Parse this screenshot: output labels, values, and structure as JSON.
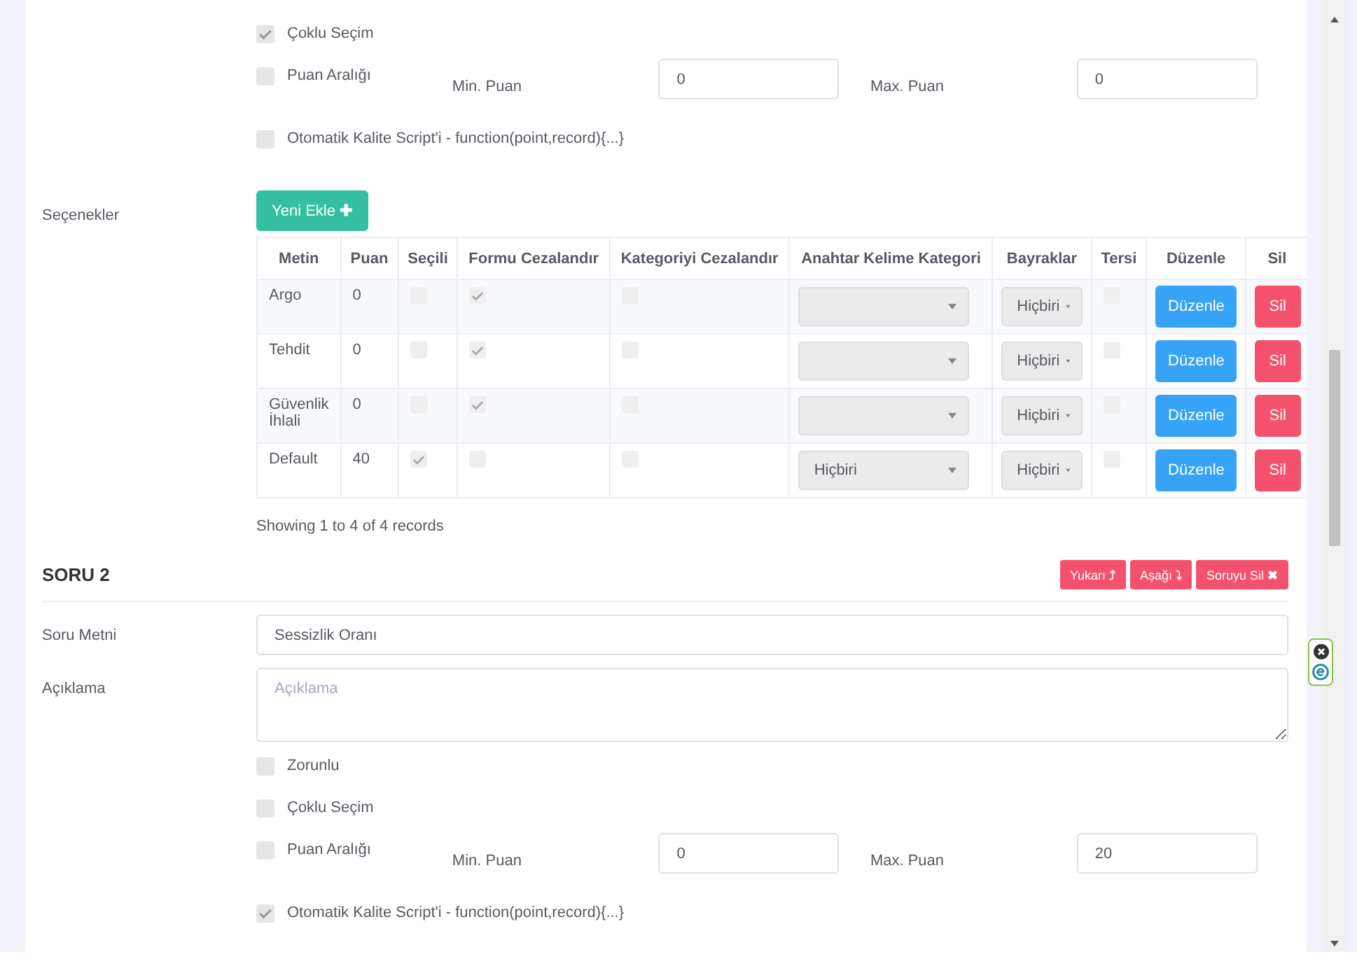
{
  "question1": {
    "options": [
      {
        "kind": "checkbox",
        "label": "Çoklu Seçim",
        "checked": true
      },
      {
        "kind": "range",
        "label": "Puan Aralığı",
        "checked": false,
        "min_label": "Min. Puan",
        "min_value": "0",
        "max_label": "Max. Puan",
        "max_value": "0"
      },
      {
        "kind": "checkbox",
        "label": "Otomatik Kalite Script'i - function(point,record){...}",
        "checked": false
      }
    ],
    "choices_label": "Seçenekler",
    "add_button": "Yeni Ekle",
    "add_icon": "✚",
    "table": {
      "columns": [
        "Metin",
        "Puan",
        "Seçili",
        "Formu Cezalandır",
        "Kategoriyi Cezalandır",
        "Anahtar Kelime Kategori",
        "Bayraklar",
        "Tersi",
        "Düzenle",
        "Sil"
      ],
      "rows": [
        {
          "text": "Argo",
          "points": "0",
          "selected": false,
          "penalize_form": true,
          "penalize_category": false,
          "keyword_category": "",
          "flags": "Hiçbiri",
          "inverse": false,
          "edit": "Düzenle",
          "delete": "Sil"
        },
        {
          "text": "Tehdit",
          "points": "0",
          "selected": false,
          "penalize_form": true,
          "penalize_category": false,
          "keyword_category": "",
          "flags": "Hiçbiri",
          "inverse": false,
          "edit": "Düzenle",
          "delete": "Sil"
        },
        {
          "text": "Güvenlik İhlali",
          "points": "0",
          "selected": false,
          "penalize_form": true,
          "penalize_category": false,
          "keyword_category": "",
          "flags": "Hiçbiri",
          "inverse": false,
          "edit": "Düzenle",
          "delete": "Sil"
        },
        {
          "text": "Default",
          "points": "40",
          "selected": true,
          "penalize_form": false,
          "penalize_category": false,
          "keyword_category": "Hiçbiri",
          "flags": "Hiçbiri",
          "inverse": false,
          "edit": "Düzenle",
          "delete": "Sil"
        }
      ],
      "footer": "Showing 1 to 4 of 4 records"
    }
  },
  "question2": {
    "title": "SORU 2",
    "buttons": [
      {
        "label": "Yukarı",
        "icon": "⤴"
      },
      {
        "label": "Aşağı",
        "icon": "⤵"
      },
      {
        "label": "Soruyu Sil",
        "icon": "✖"
      }
    ],
    "text_label": "Soru Metni",
    "text_value": "Sessizlik Oranı",
    "description_label": "Açıklama",
    "description_placeholder": "Açıklama",
    "options": [
      {
        "kind": "checkbox",
        "label": "Zorunlu",
        "checked": false
      },
      {
        "kind": "checkbox",
        "label": "Çoklu Seçim",
        "checked": false
      },
      {
        "kind": "range",
        "label": "Puan Aralığı",
        "checked": false,
        "min_label": "Min. Puan",
        "min_value": "0",
        "max_label": "Max. Puan",
        "max_value": "20"
      },
      {
        "kind": "checkbox",
        "label": "Otomatik Kalite Script'i - function(point,record){...}",
        "checked": true
      }
    ]
  }
}
